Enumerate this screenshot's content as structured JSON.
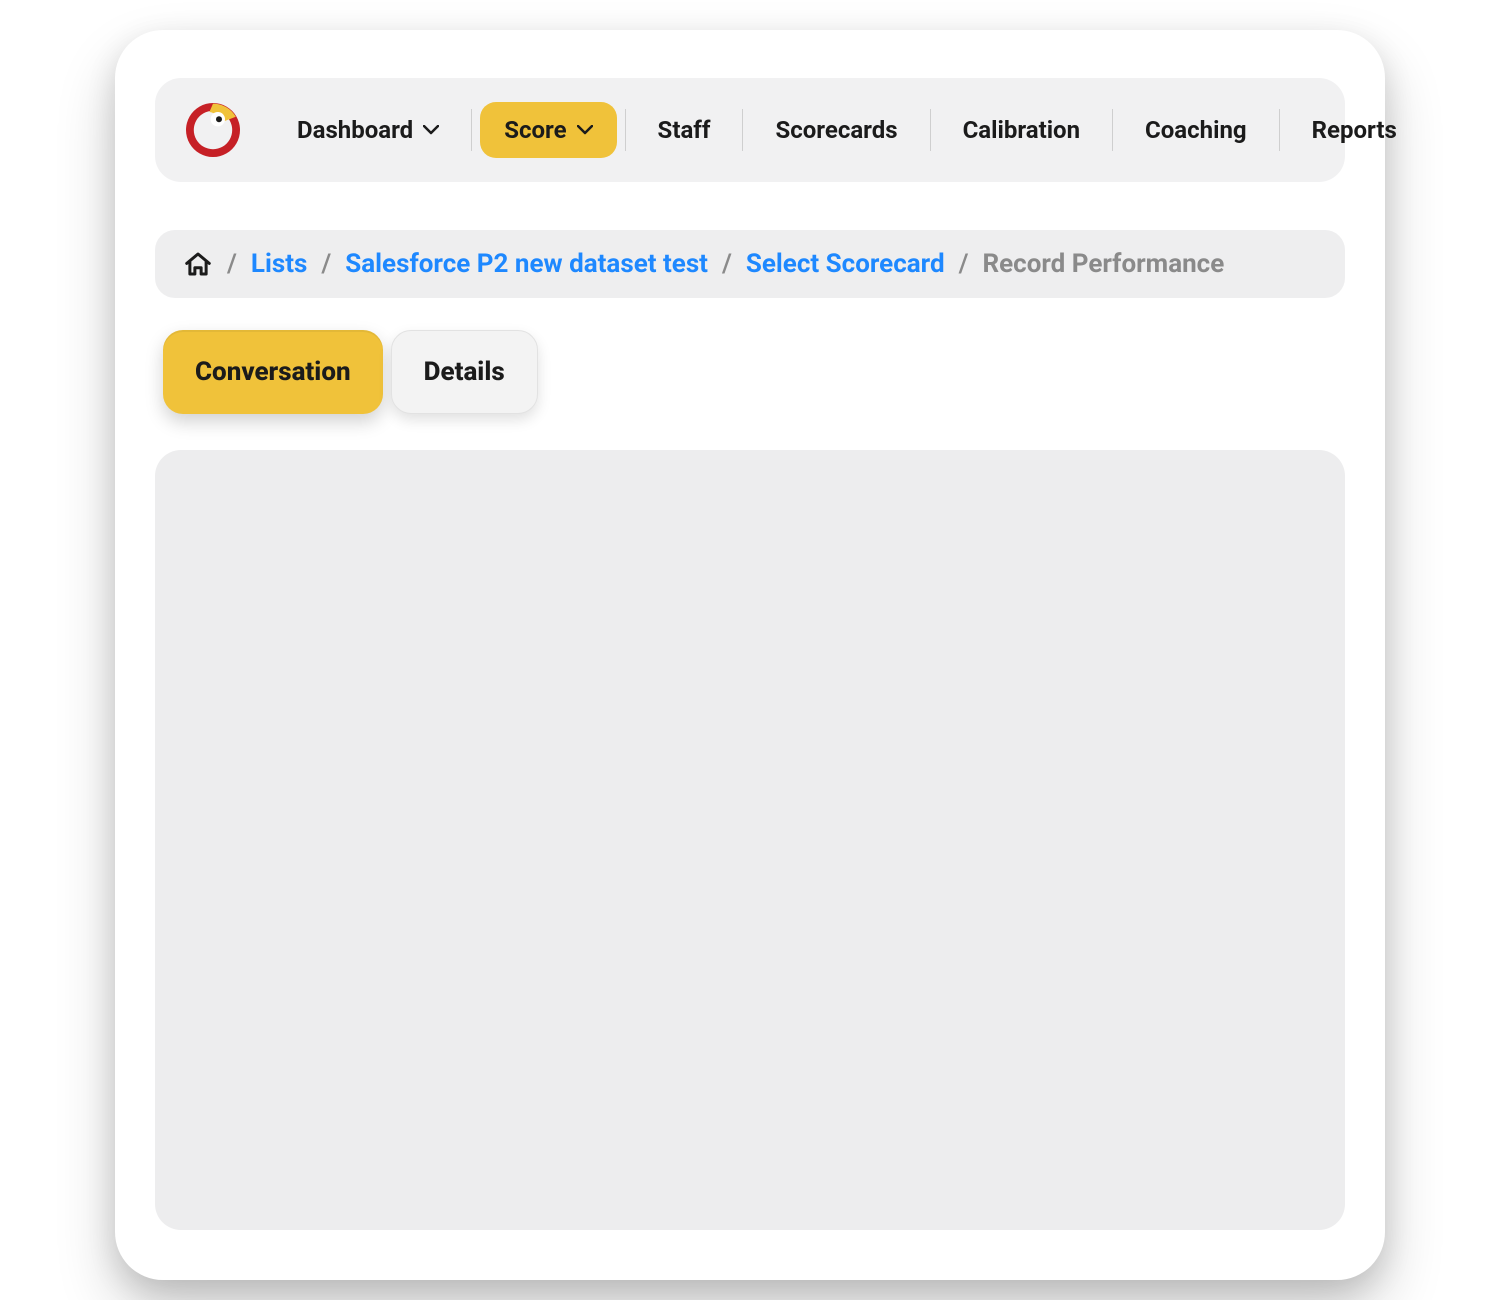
{
  "nav": {
    "items": [
      {
        "label": "Dashboard",
        "has_dropdown": true,
        "active": false
      },
      {
        "label": "Score",
        "has_dropdown": true,
        "active": true
      },
      {
        "label": "Staff",
        "has_dropdown": false,
        "active": false
      },
      {
        "label": "Scorecards",
        "has_dropdown": false,
        "active": false
      },
      {
        "label": "Calibration",
        "has_dropdown": false,
        "active": false
      },
      {
        "label": "Coaching",
        "has_dropdown": false,
        "active": false
      },
      {
        "label": "Reports",
        "has_dropdown": false,
        "active": false
      }
    ]
  },
  "breadcrumb": {
    "items": [
      {
        "label": "Lists",
        "kind": "link"
      },
      {
        "label": "Salesforce P2 new dataset test",
        "kind": "link"
      },
      {
        "label": "Select Scorecard",
        "kind": "link"
      },
      {
        "label": "Record Performance",
        "kind": "current"
      }
    ]
  },
  "tabs": {
    "items": [
      {
        "label": "Conversation",
        "active": true
      },
      {
        "label": "Details",
        "active": false
      }
    ]
  },
  "colors": {
    "accent": "#f0c23a",
    "link": "#1e88ff",
    "panel": "#ededee",
    "nav_bg": "#f1f1f2"
  }
}
